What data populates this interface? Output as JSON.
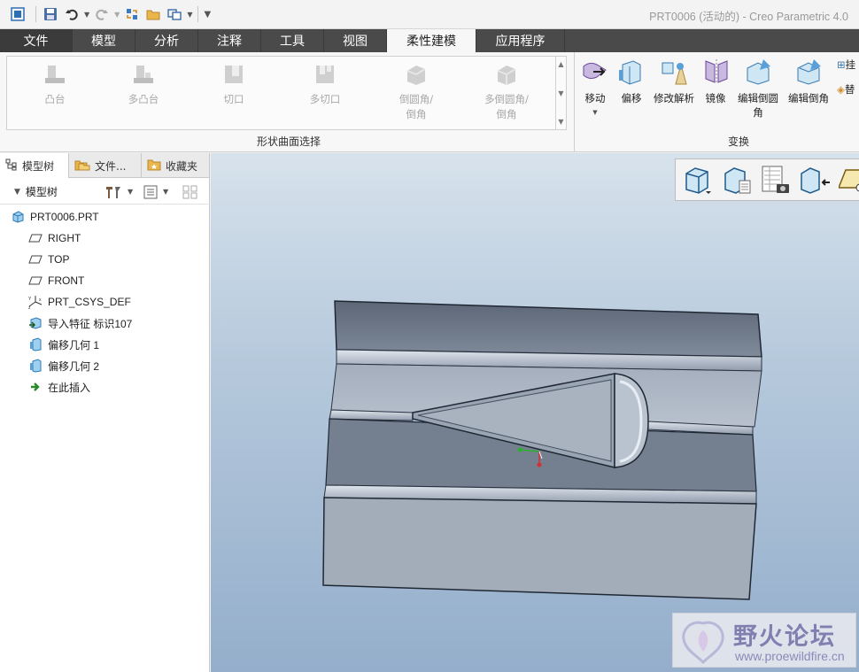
{
  "window": {
    "title": "PRT0006 (活动的) - Creo Parametric 4.0"
  },
  "quick_access": {
    "icons": [
      "window-icon",
      "save-icon",
      "undo-icon",
      "redo-icon",
      "regenerate-icon",
      "open-icon",
      "windows-icon",
      "customize-icon"
    ]
  },
  "menu_tabs": [
    {
      "label": "文件"
    },
    {
      "label": "模型"
    },
    {
      "label": "分析"
    },
    {
      "label": "注释"
    },
    {
      "label": "工具"
    },
    {
      "label": "视图"
    },
    {
      "label": "柔性建模"
    },
    {
      "label": "应用程序"
    }
  ],
  "ribbon": {
    "shape_select": {
      "items": [
        {
          "label": "凸台"
        },
        {
          "label": "多凸台"
        },
        {
          "label": "切口"
        },
        {
          "label": "多切口"
        },
        {
          "label": "倒圆角/\n倒角"
        },
        {
          "label": "多倒圆角/\n倒角"
        }
      ],
      "group_label": "形状曲面选择"
    },
    "transform": {
      "items": [
        {
          "label": "移动"
        },
        {
          "label": "偏移"
        },
        {
          "label": "修改解析"
        },
        {
          "label": "镜像"
        },
        {
          "label": "编辑倒圆\n角"
        },
        {
          "label": "编辑倒角"
        }
      ],
      "extra": [
        "挂",
        "替"
      ],
      "group_label": "变换"
    }
  },
  "left_panel": {
    "tabs": [
      {
        "label": "模型树"
      },
      {
        "label": "文件..."
      },
      {
        "label": "收藏夹"
      }
    ],
    "tree_header": "模型树",
    "tree": [
      {
        "label": "PRT0006.PRT",
        "icon": "part-icon"
      },
      {
        "label": "RIGHT",
        "icon": "datum-plane-icon"
      },
      {
        "label": "TOP",
        "icon": "datum-plane-icon"
      },
      {
        "label": "FRONT",
        "icon": "datum-plane-icon"
      },
      {
        "label": "PRT_CSYS_DEF",
        "icon": "csys-icon"
      },
      {
        "label": "导入特征 标识107",
        "icon": "import-feature-icon"
      },
      {
        "label": "偏移几何 1",
        "icon": "offset-geometry-icon"
      },
      {
        "label": "偏移几何 2",
        "icon": "offset-geometry-icon"
      },
      {
        "label": "在此插入",
        "icon": "insert-here-icon"
      }
    ]
  },
  "watermark": {
    "title": "野火论坛",
    "url": "www.proewildfire.cn"
  },
  "colors": {
    "tab_bar": "#4a4a4a",
    "active_tab": "#f7f7f7",
    "viewport_top": "#d7e2ec",
    "viewport_bottom": "#94aecb"
  }
}
